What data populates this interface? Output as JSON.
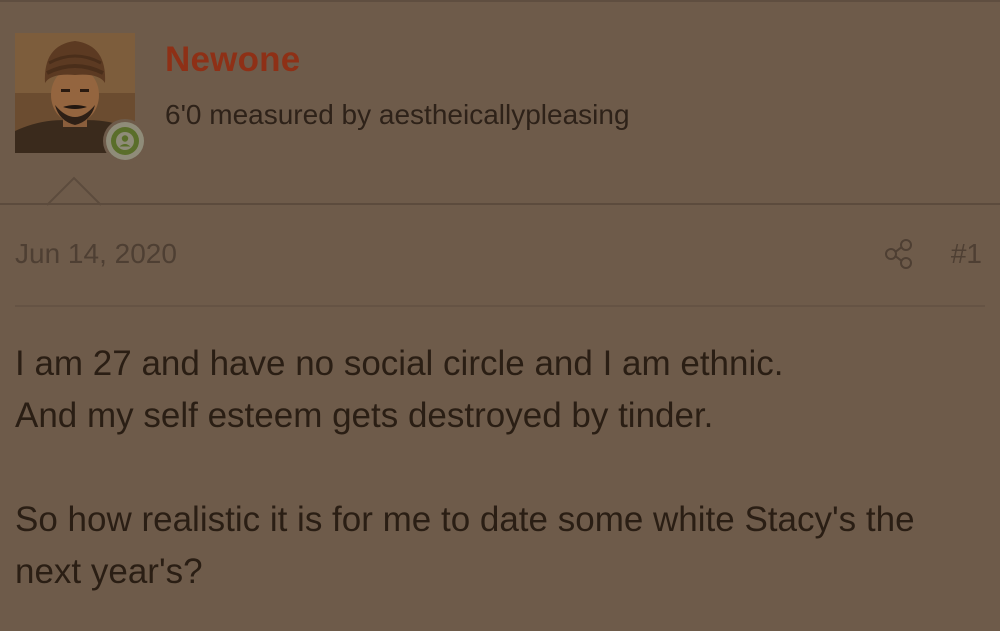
{
  "post": {
    "author": {
      "username": "Newone",
      "title": "6'0 measured by aestheicallypleasing",
      "avatar_icon": "avatar-photo",
      "online_badge_icon": "user-icon",
      "username_color": "#8e3016"
    },
    "meta": {
      "date": "Jun 14, 2020",
      "share_icon": "share-icon",
      "post_number": "#1"
    },
    "body": {
      "line1": "I am 27 and have no social circle and I am ethnic.",
      "line2": "And my self esteem gets destroyed by tinder.",
      "line3": "So how realistic it is for me to date some white Stacy's the next year's?"
    }
  },
  "colors": {
    "background": "#6e5b4a",
    "text": "#2a1e14",
    "muted_text": "#4e3f33",
    "online": "#5a6e2a"
  }
}
